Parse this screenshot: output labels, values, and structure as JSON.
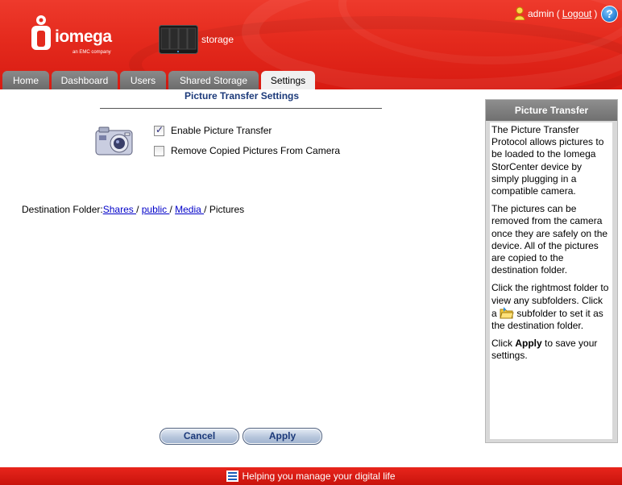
{
  "header": {
    "logo_text": "iomega",
    "logo_sub": "an EMC company",
    "device_name": "storage",
    "user": "admin",
    "logout_label": "Logout",
    "help_label": "?"
  },
  "tabs": [
    {
      "label": "Home",
      "active": false
    },
    {
      "label": "Dashboard",
      "active": false
    },
    {
      "label": "Users",
      "active": false
    },
    {
      "label": "Shared Storage",
      "active": false
    },
    {
      "label": "Settings",
      "active": true
    }
  ],
  "main": {
    "title": "Picture Transfer Settings",
    "options": [
      {
        "label": "Enable Picture Transfer",
        "checked": true
      },
      {
        "label": "Remove Copied Pictures From Camera",
        "checked": false
      }
    ],
    "destination": {
      "label": "Destination Folder:",
      "path": [
        "Shares ",
        "public ",
        "Media ",
        "Pictures"
      ]
    },
    "cancel_label": "Cancel",
    "apply_label": "Apply"
  },
  "side": {
    "title": "Picture Transfer",
    "p1": "The Picture Transfer Protocol allows pictures to be loaded to the Iomega StorCenter device by simply plugging in a compatible camera.",
    "p2": "The pictures can be removed from the camera once they are safely on the device. All of the pictures are copied to the destination folder.",
    "p3a": "Click the rightmost folder to view any subfolders. Click a",
    "p3b": " subfolder to set it as the destination folder.",
    "p4a": "Click ",
    "p4b": "Apply",
    "p4c": " to save your settings."
  },
  "footer": {
    "tagline": "Helping you manage your digital life"
  },
  "colors": {
    "brand_red": "#e42a1d",
    "tab_gray": "#787878",
    "title_blue": "#1c3a7a",
    "link_blue": "#0000c8"
  }
}
